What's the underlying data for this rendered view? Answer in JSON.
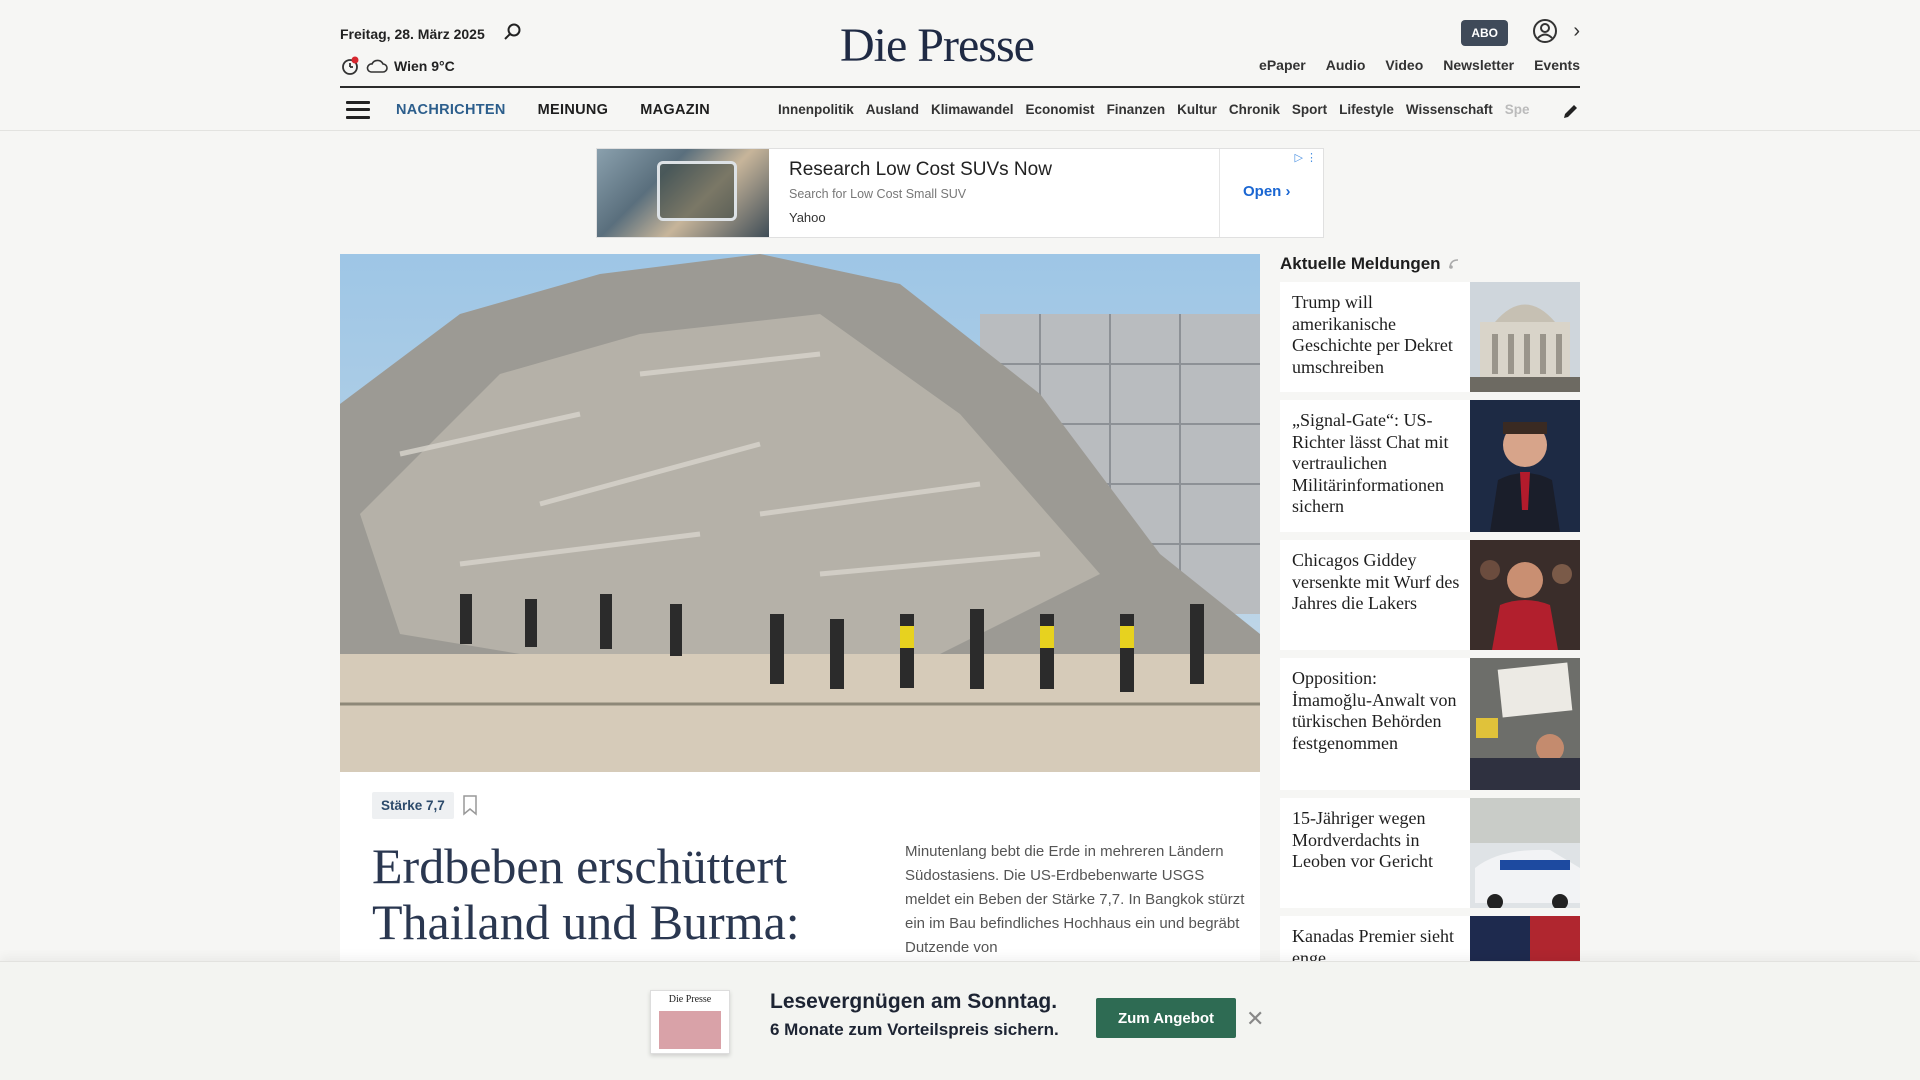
{
  "header": {
    "date": "Freitag, 28. März 2025",
    "weather": "Wien 9°C",
    "logo": "Die Presse",
    "abo": "ABO",
    "top_links": [
      "ePaper",
      "Audio",
      "Video",
      "Newsletter",
      "Events"
    ],
    "main_nav": [
      "NACHRICHTEN",
      "MEINUNG",
      "MAGAZIN"
    ],
    "sub_nav": [
      "Innenpolitik",
      "Ausland",
      "Klimawandel",
      "Economist",
      "Finanzen",
      "Kultur",
      "Chronik",
      "Sport",
      "Lifestyle",
      "Wissenschaft",
      "Spectr"
    ]
  },
  "ad": {
    "title": "Research Low Cost SUVs Now",
    "subtitle": "Search for Low Cost Small SUV",
    "source": "Yahoo",
    "cta": "Open"
  },
  "article": {
    "tag": "Stärke 7,7",
    "headline": "Erdbeben erschüttert Thailand und Burma:",
    "teaser": "Minutenlang bebt die Erde in mehreren Ländern Südostasiens. Die US-Erdbebenwarte USGS meldet ein Beben der Stärke 7,7. In Bangkok stürzt ein im Bau befindliches Hochhaus ein und begräbt Dutzende von"
  },
  "sidebar": {
    "title": "Aktuelle Meldungen",
    "items": [
      {
        "title": "Trump will amerikanische Geschichte per Dekret umschreiben"
      },
      {
        "title": "„Signal-Gate“: US-Richter lässt Chat mit vertraulichen Militärinformationen sichern"
      },
      {
        "title": "Chicagos Giddey versenkte mit Wurf des Jahres die Lakers"
      },
      {
        "title": "Opposition: İmamoğlu-Anwalt von türkischen Behörden festgenommen"
      },
      {
        "title": "15-Jähriger wegen Mordverdachts in Leoben vor Gericht"
      },
      {
        "title": "Kanadas Premier sieht enge"
      }
    ]
  },
  "banner": {
    "magazine_logo": "Die Presse",
    "title": "Lesevergnügen am Sonntag.",
    "subtitle": "6 Monate zum Vorteilspreis sichern.",
    "button": "Zum Angebot"
  },
  "colors": {
    "brand_navy": "#1f2a44",
    "nav_active": "#2c5e8c",
    "cta_green": "#2e6b53"
  }
}
